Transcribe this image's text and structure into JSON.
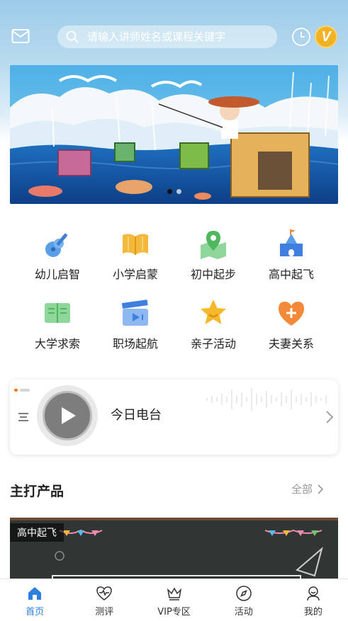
{
  "header": {
    "search_placeholder": "请输入讲师姓名或课程关键字",
    "vip_badge": "V",
    "icons": [
      "mail-icon",
      "search-icon",
      "clock-icon"
    ]
  },
  "banner": {
    "slide_count": 2,
    "active_slide": 0
  },
  "categories": [
    {
      "label": "幼儿启智",
      "icon": "guitar-icon",
      "color": "#5b9ee8"
    },
    {
      "label": "小学启蒙",
      "icon": "open-book-icon",
      "color": "#f4b93a"
    },
    {
      "label": "初中起步",
      "icon": "map-pin-icon",
      "color": "#5cc46b"
    },
    {
      "label": "高中起飞",
      "icon": "castle-icon",
      "color": "#3f7fe0"
    },
    {
      "label": "大学求索",
      "icon": "book-icon",
      "color": "#6cc46d"
    },
    {
      "label": "职场起航",
      "icon": "clapperboard-icon",
      "color": "#5b8fe8"
    },
    {
      "label": "亲子活动",
      "icon": "star-icon",
      "color": "#f6b92c"
    },
    {
      "label": "夫妻关系",
      "icon": "heart-plus-icon",
      "color": "#f28a3a"
    }
  ],
  "radio": {
    "title": "今日电台"
  },
  "products_section": {
    "title": "主打产品",
    "more_label": "全部"
  },
  "product_card": {
    "tag": "高中起飞"
  },
  "tabbar": [
    {
      "label": "首页",
      "icon": "home-icon",
      "active": true
    },
    {
      "label": "测评",
      "icon": "heart-pulse-icon",
      "active": false
    },
    {
      "label": "VIP专区",
      "icon": "crown-icon",
      "active": false
    },
    {
      "label": "活动",
      "icon": "compass-icon",
      "active": false
    },
    {
      "label": "我的",
      "icon": "user-icon",
      "active": false
    }
  ],
  "colors": {
    "accent": "#2d7fe0",
    "vip": "#f1b323",
    "header_top": "#9ccbe9"
  }
}
